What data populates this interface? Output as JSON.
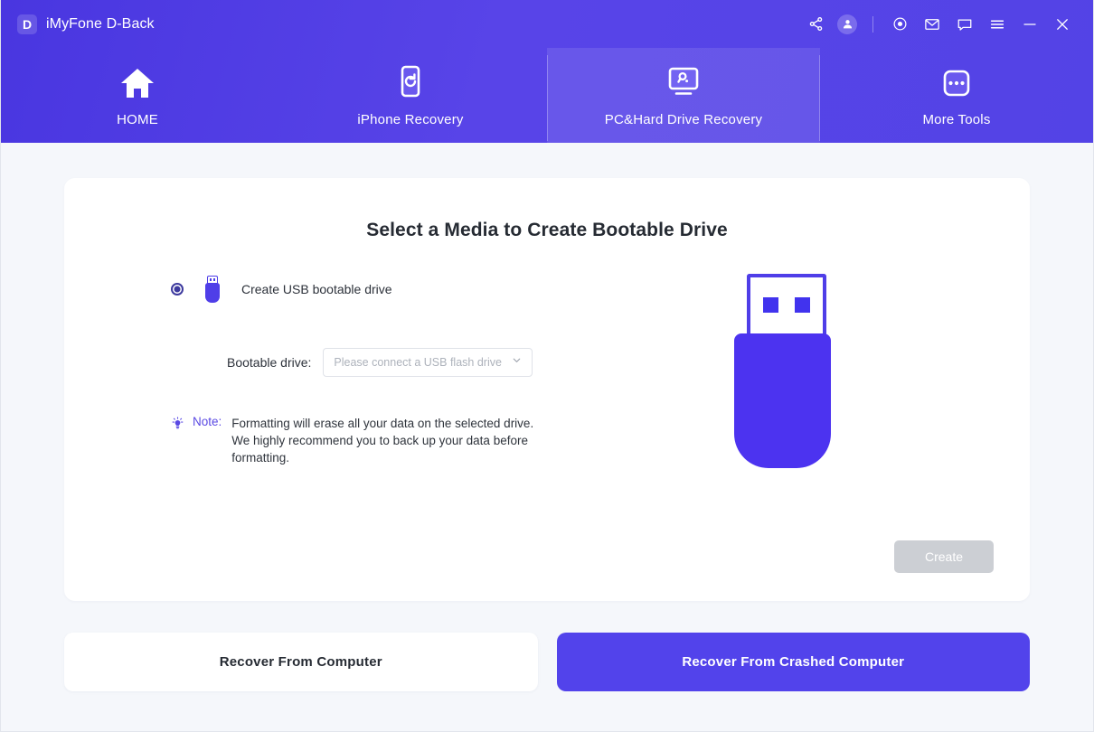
{
  "titlebar": {
    "logo_letter": "D",
    "app_name": "iMyFone D-Back",
    "icons": [
      {
        "name": "share-icon",
        "label": "Share"
      },
      {
        "name": "account-avatar-icon",
        "label": "Account"
      },
      {
        "name": "target-icon",
        "label": "Record"
      },
      {
        "name": "mail-icon",
        "label": "Feedback"
      },
      {
        "name": "chat-icon",
        "label": "Support Chat"
      },
      {
        "name": "menu-icon",
        "label": "Menu"
      },
      {
        "name": "minimize-icon",
        "label": "Minimize"
      },
      {
        "name": "close-icon",
        "label": "Close"
      }
    ]
  },
  "nav": {
    "tabs": [
      {
        "id": "home",
        "label": "HOME",
        "icon": "home-icon",
        "active": false
      },
      {
        "id": "iphone-recovery",
        "label": "iPhone Recovery",
        "icon": "phone-refresh-icon",
        "active": false
      },
      {
        "id": "pc-hard-drive-recovery",
        "label": "PC&Hard Drive Recovery",
        "icon": "monitor-search-icon",
        "active": true
      },
      {
        "id": "more-tools",
        "label": "More Tools",
        "icon": "more-dots-icon",
        "active": false
      }
    ]
  },
  "card": {
    "title": "Select a Media to Create Bootable Drive",
    "option": {
      "label": "Create USB bootable drive",
      "selected": true,
      "icon": "usb-drive-icon"
    },
    "field": {
      "label": "Bootable drive:",
      "value": "",
      "placeholder": "Please connect a USB flash drive",
      "options": []
    },
    "note": {
      "icon": "lightbulb-icon",
      "label": "Note:",
      "text": "Formatting will erase all your data on the selected drive. We highly recommend you to back up your data before formatting."
    },
    "illustration": "usb-flash-drive-illustration",
    "create_button": {
      "label": "Create",
      "enabled": false
    }
  },
  "bottom": {
    "recover_from_computer": "Recover From Computer",
    "recover_from_crashed_computer": "Recover From Crashed Computer"
  },
  "colors": {
    "header_gradient_start": "#4936e0",
    "header_gradient_end": "#5343e6",
    "accent": "#5243eb",
    "usb_purple": "#4c33f0",
    "note_purple": "#5a49e3",
    "disabled_button": "#cccfd4",
    "page_background": "#f5f7fb"
  }
}
